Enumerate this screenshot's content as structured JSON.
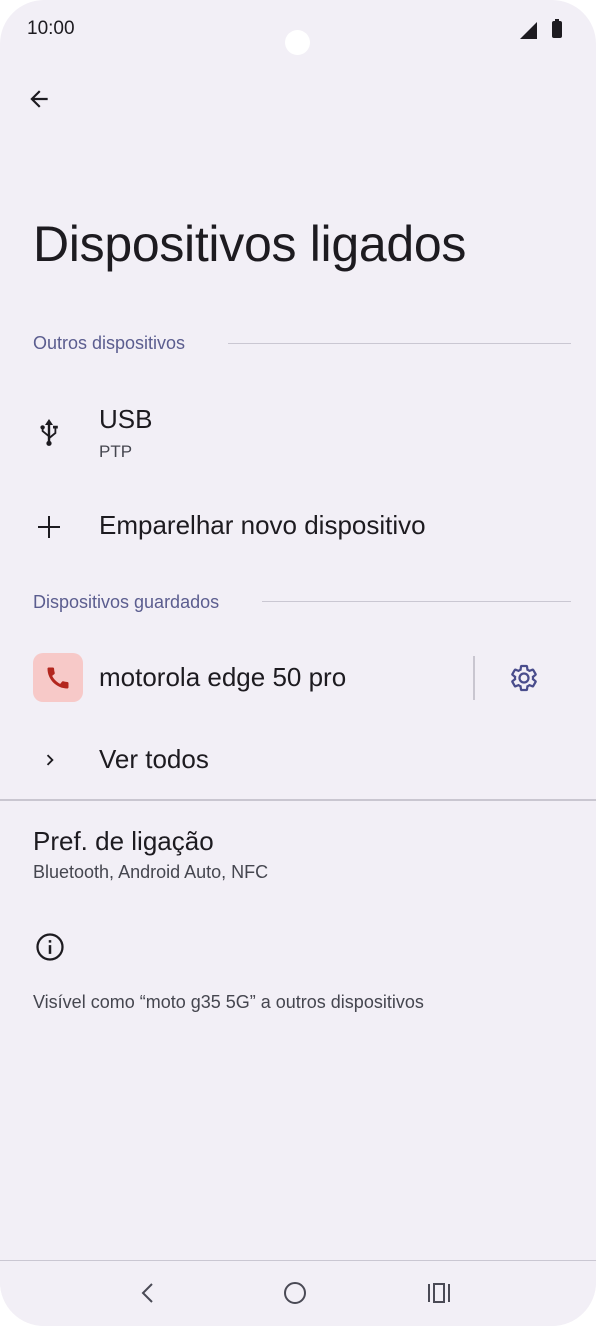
{
  "status_bar": {
    "time": "10:00"
  },
  "header": {
    "title": "Dispositivos ligados",
    "back_icon": "arrow-back-icon"
  },
  "sections": {
    "other": {
      "label": "Outros dispositivos",
      "items": [
        {
          "title": "USB",
          "subtitle": "PTP",
          "icon": "usb-icon"
        },
        {
          "title": "Emparelhar novo dispositivo",
          "icon": "plus-icon"
        }
      ]
    },
    "saved": {
      "label": "Dispositivos guardados",
      "device": {
        "name": "motorola edge 50 pro",
        "icon": "phone-icon",
        "settings_icon": "gear-icon",
        "chip_color": "#f7c9c8",
        "icon_color": "#b3261e"
      },
      "see_all": "Ver todos"
    }
  },
  "preferences": {
    "title": "Pref. de ligação",
    "subtitle": "Bluetooth, Android Auto, NFC"
  },
  "footer_info": {
    "icon": "info-icon",
    "text": "Visível como “moto g35 5G” a outros dispositivos"
  },
  "colors": {
    "background": "#f2eff6",
    "accent": "#5b5d8f",
    "text": "#1d1b20"
  }
}
